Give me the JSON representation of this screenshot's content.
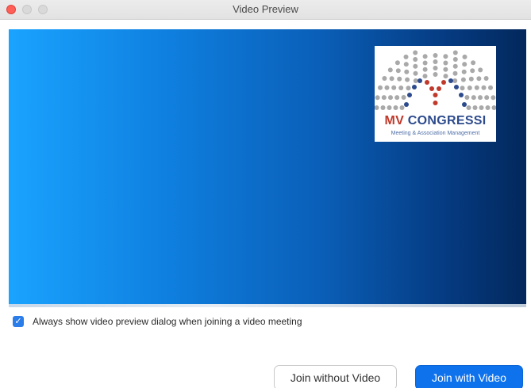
{
  "window": {
    "title": "Video Preview"
  },
  "logo": {
    "brand_mv": "MV",
    "brand_rest": " CONGRESSI",
    "tagline": "Meeting & Association Management"
  },
  "options": {
    "always_show_preview": {
      "label": "Always show video preview dialog when joining a video meeting",
      "checked": true
    }
  },
  "buttons": {
    "join_without_video": "Join without Video",
    "join_with_video": "Join with Video"
  },
  "icons": {
    "checkmark": "check-icon"
  },
  "colors": {
    "primary": "#0e72ed",
    "checkbox": "#2b7de9",
    "logo_red": "#c0392b",
    "logo_blue": "#2c4a8c",
    "close_button": "#fe5f57"
  }
}
